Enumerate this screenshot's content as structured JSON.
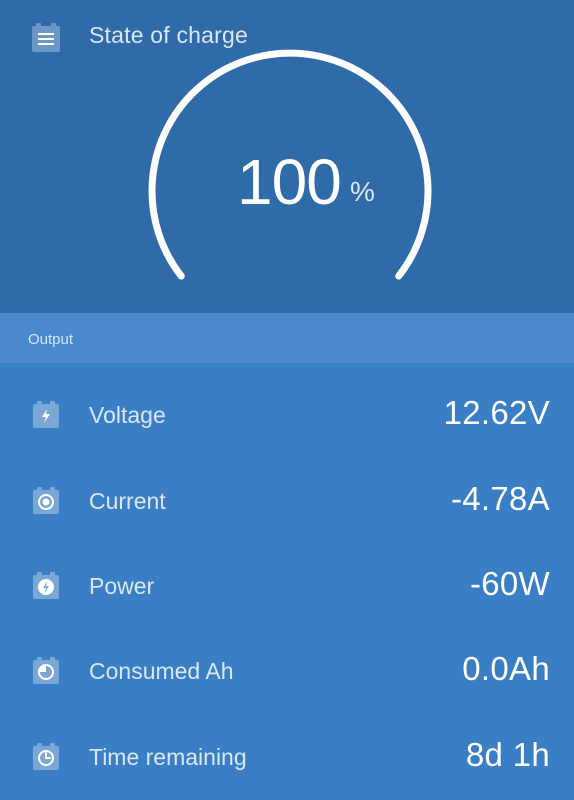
{
  "header": {
    "title": "State of charge",
    "menu_icon": "menu-icon"
  },
  "gauge": {
    "value": "100",
    "unit": "%",
    "fraction": 1.0
  },
  "section": {
    "label": "Output"
  },
  "rows": [
    {
      "label": "Voltage",
      "value": "12.62V",
      "icon": "lightning-icon"
    },
    {
      "label": "Current",
      "value": "-4.78A",
      "icon": "current-icon"
    },
    {
      "label": "Power",
      "value": "-60W",
      "icon": "power-icon"
    },
    {
      "label": "Consumed Ah",
      "value": "0.0Ah",
      "icon": "consumed-icon"
    },
    {
      "label": "Time remaining",
      "value": "8d 1h",
      "icon": "clock-icon"
    }
  ],
  "colors": {
    "top_background": "#2f6aa9",
    "section_bar": "#4a89cc",
    "list_background": "#3a7fc6"
  }
}
